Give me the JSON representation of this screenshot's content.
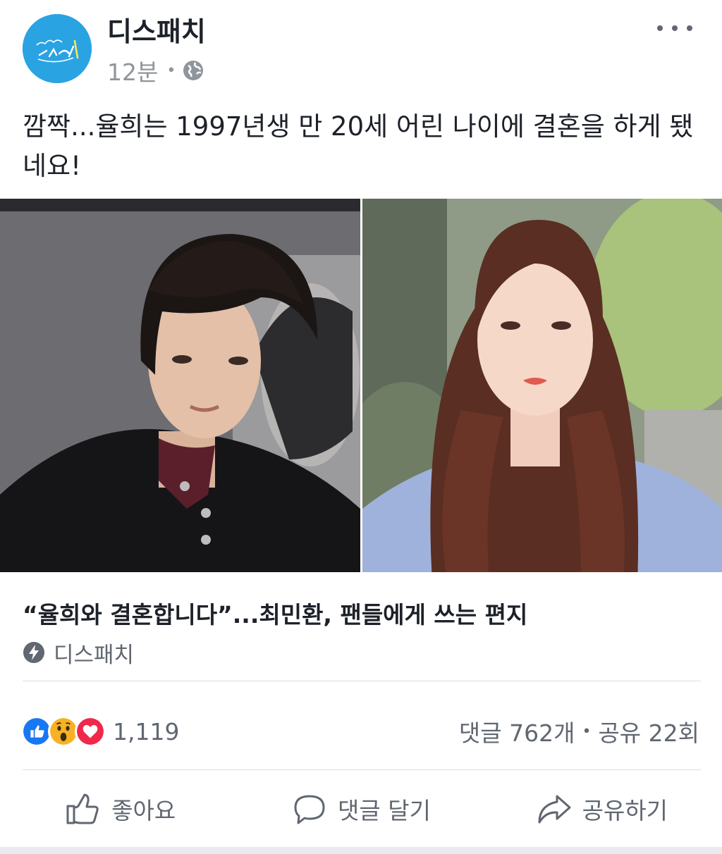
{
  "header": {
    "page_name": "디스패치",
    "time": "12분",
    "separator": "•",
    "avatar_text": "디스패치",
    "privacy_icon": "globe-icon",
    "menu_icon": "more-horizontal-icon"
  },
  "post": {
    "text": "깜짝...율희는 1997년생 만 20세 어린 나이에 결혼을 하게 됐네요!"
  },
  "link": {
    "title": "“율희와 결혼합니다”...최민환, 팬들에게 쓰는 편지",
    "source": "디스패치",
    "source_icon": "lightning-bolt-icon"
  },
  "reactions": {
    "icons": [
      "like-icon",
      "wow-icon",
      "love-icon"
    ],
    "count": "1,119"
  },
  "engagement": {
    "comments": "댓글 762개",
    "separator": "•",
    "shares": "공유 22회"
  },
  "actions": {
    "like": "좋아요",
    "comment": "댓글 달기",
    "share": "공유하기"
  },
  "colors": {
    "avatar_bg": "#2aa3e3",
    "like_blue": "#1877f2",
    "love_red": "#f0284a",
    "wow_yellow": "#f7b125",
    "secondary_text": "#606770",
    "divider": "#dadde1"
  }
}
